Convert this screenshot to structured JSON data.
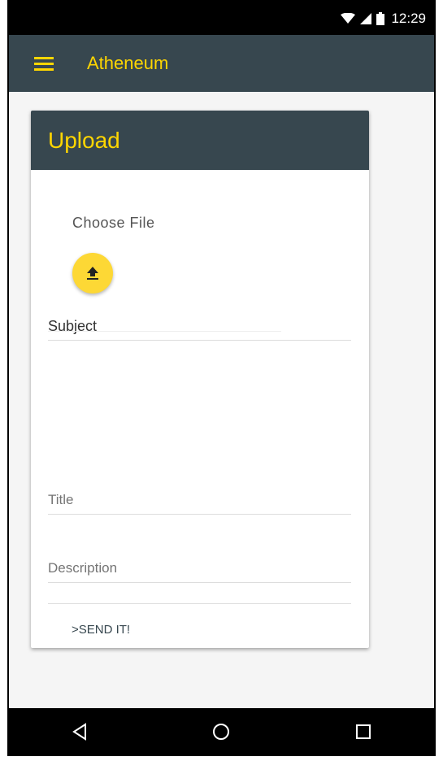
{
  "status_bar": {
    "time": "12:29"
  },
  "app_bar": {
    "title": "Atheneum"
  },
  "card": {
    "header": "Upload",
    "choose_file_label": "Choose File",
    "subject_label": "Subject",
    "title_placeholder": "Title",
    "description_placeholder": "Description",
    "send_label": ">SEND IT!"
  },
  "colors": {
    "primary": "#37474f",
    "accent": "#ffd600",
    "fab": "#fdd835"
  },
  "icons": {
    "menu": "menu-icon",
    "upload": "upload-icon",
    "back": "back-icon",
    "home": "home-icon",
    "recents": "recents-icon"
  }
}
